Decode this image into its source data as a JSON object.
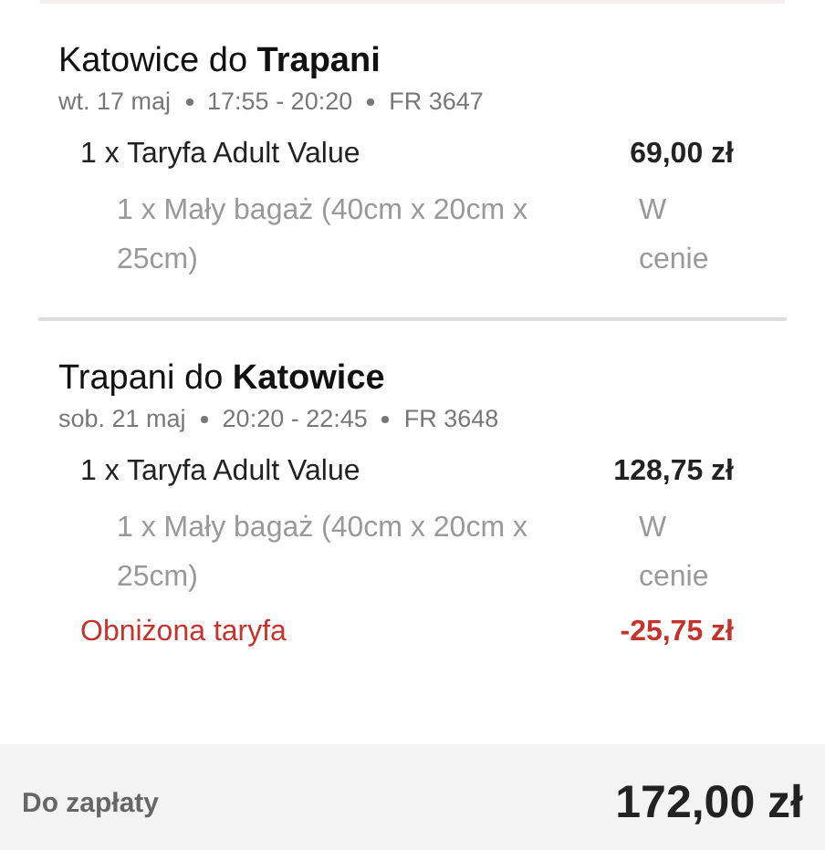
{
  "flights": [
    {
      "title": "Katowice do **Trapani**",
      "date": "wt. 17 maj",
      "time": "17:55 - 20:20",
      "flight_no": "FR 3647",
      "items": [
        {
          "kind": "fare",
          "label": "1 x Taryfa Adult Value",
          "price": "69,00 zł"
        },
        {
          "kind": "baggage",
          "label": "1 x Mały bagaż (40cm x 20cm x 25cm)",
          "price": "W cenie"
        }
      ]
    },
    {
      "title": "Trapani do **Katowice**",
      "date": "sob. 21 maj",
      "time": "20:20 - 22:45",
      "flight_no": "FR 3648",
      "items": [
        {
          "kind": "fare",
          "label": "1 x Taryfa Adult Value",
          "price": "128,75 zł"
        },
        {
          "kind": "baggage",
          "label": "1 x Mały bagaż (40cm x 20cm x 25cm)",
          "price": "W cenie"
        },
        {
          "kind": "discount",
          "label": "Obniżona taryfa",
          "price": "-25,75 zł"
        }
      ]
    }
  ],
  "total": {
    "label": "Do zapłaty",
    "amount": "172,00 zł"
  }
}
